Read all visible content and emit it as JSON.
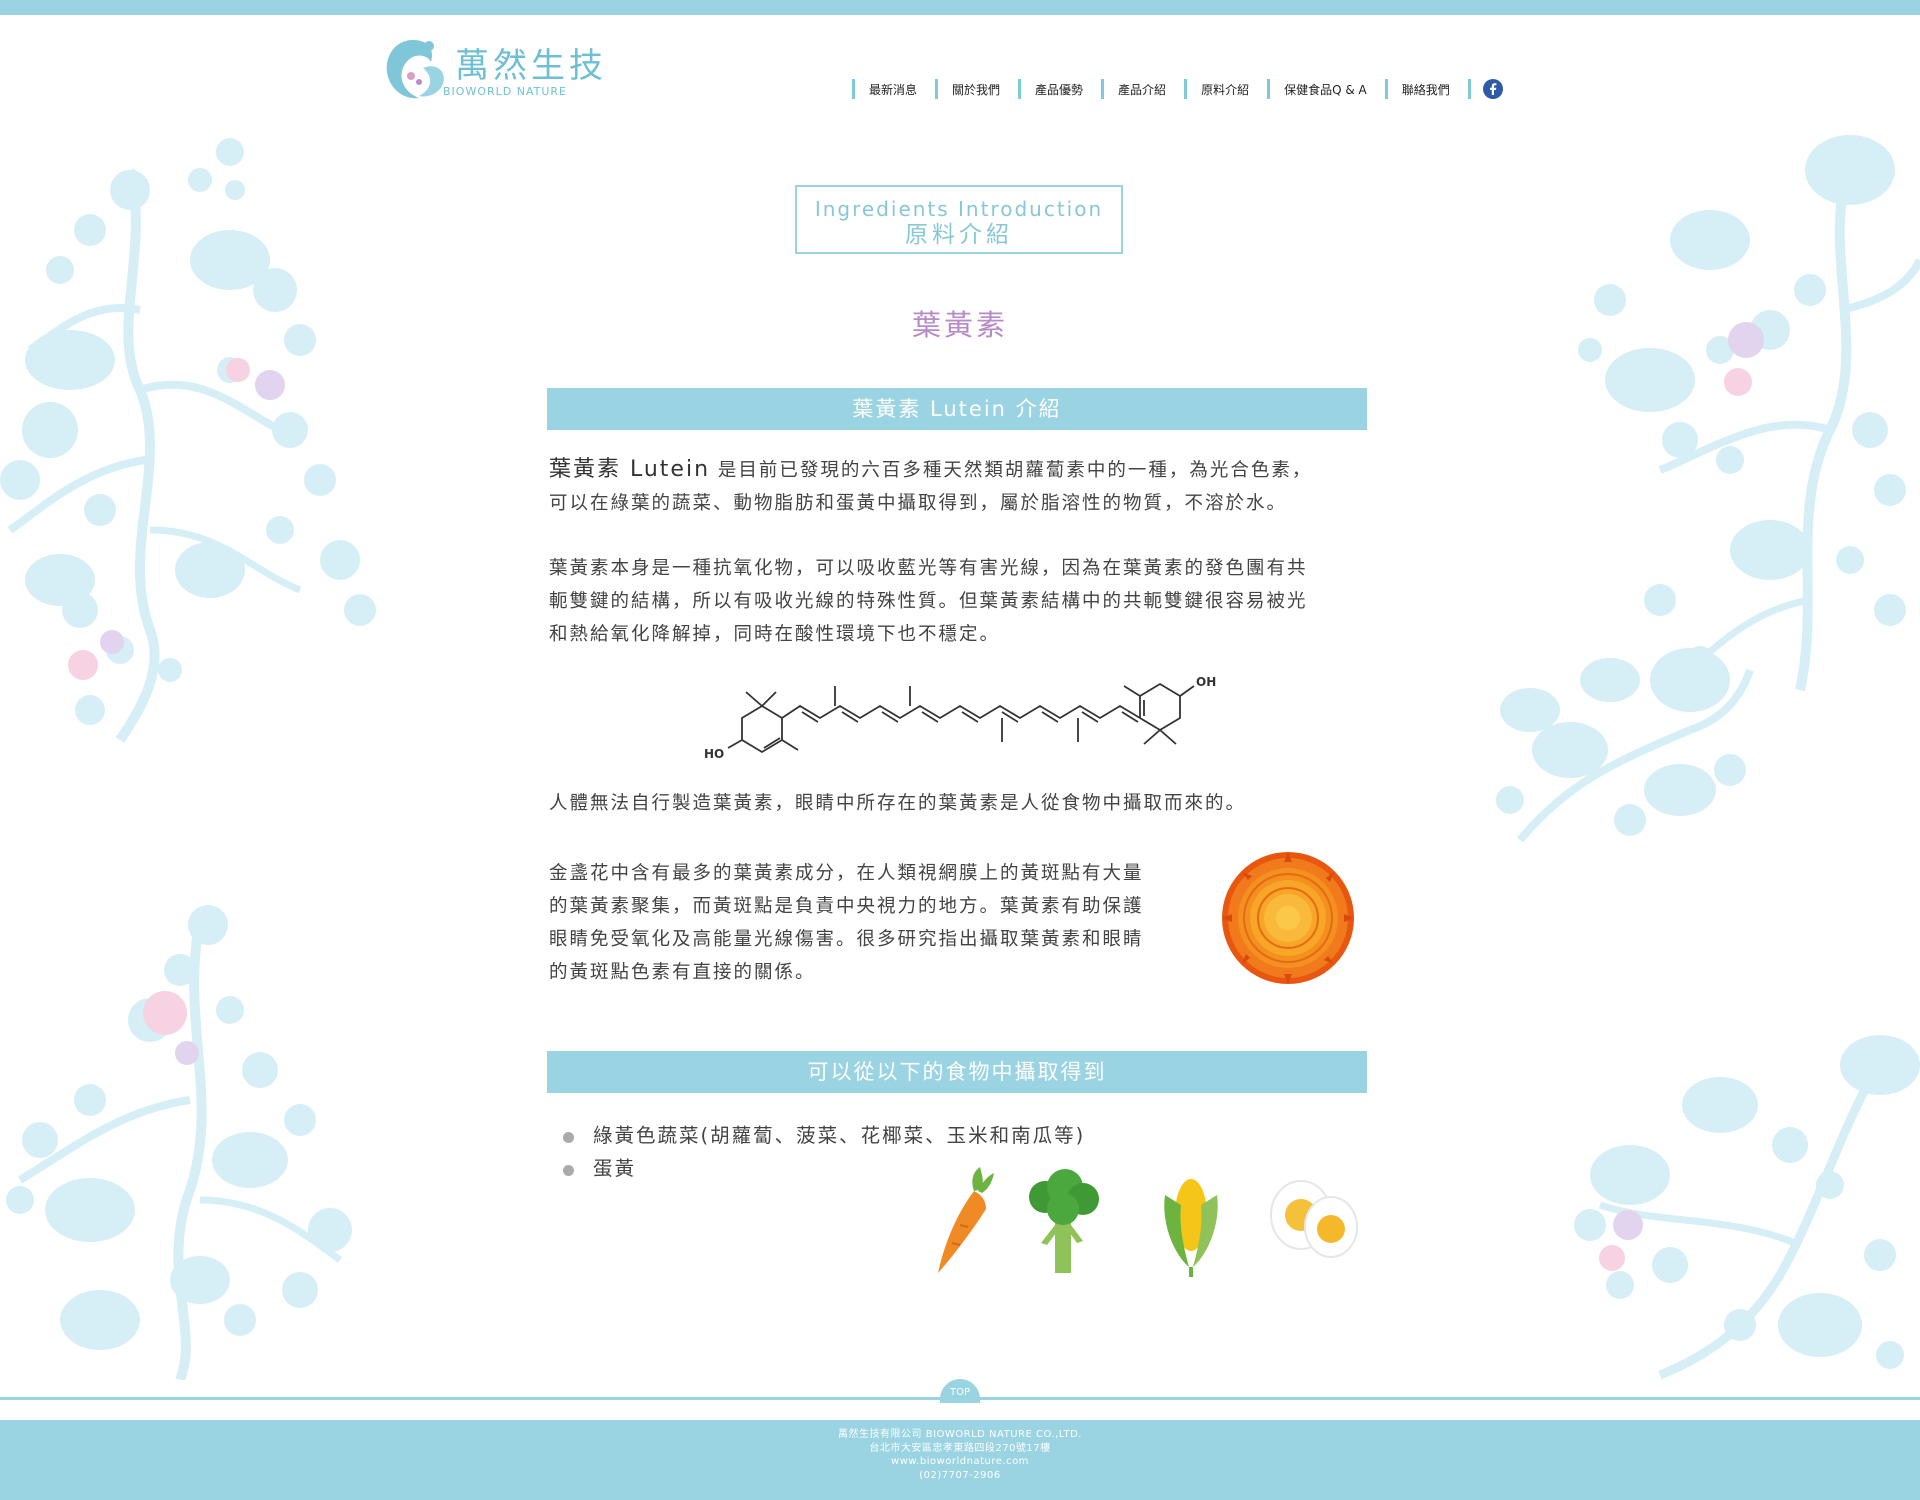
{
  "brand": {
    "name": "萬然生技",
    "sub": "BIOWORLD NATURE"
  },
  "nav": {
    "items": [
      "最新消息",
      "關於我們",
      "產品優勢",
      "產品介紹",
      "原料介紹",
      "保健食品Q & A",
      "聯絡我們"
    ],
    "facebook_icon": "facebook-icon"
  },
  "section": {
    "en": "Ingredients Introduction",
    "zh": "原料介紹"
  },
  "page_title": "葉黃素",
  "intro_bar": "葉黃素 Lutein 介紹",
  "para1": {
    "lead": "葉黃素 Lutein",
    "line1_rest": " 是目前已發現的六百多種天然類胡蘿蔔素中的一種，為光合色素，",
    "line2": "可以在綠葉的蔬菜、動物脂肪和蛋黃中攝取得到，屬於脂溶性的物質，不溶於水。"
  },
  "para2": [
    "葉黃素本身是一種抗氧化物，可以吸收藍光等有害光線，因為在葉黃素的發色團有共",
    "軛雙鍵的結構，所以有吸收光線的特殊性質。但葉黃素結構中的共軛雙鍵很容易被光",
    "和熱給氧化降解掉，同時在酸性環境下也不穩定。"
  ],
  "molecule": {
    "oh_label": "OH",
    "ho_label": "HO"
  },
  "para3": "人體無法自行製造葉黃素，眼睛中所存在的葉黃素是人從食物中攝取而來的。",
  "para4": [
    "金盞花中含有最多的葉黃素成分，在人類視網膜上的黃斑點有大量",
    "的葉黃素聚集，而黃斑點是負責中央視力的地方。葉黃素有助保護",
    "眼睛免受氧化及高能量光線傷害。很多研究指出攝取葉黃素和眼睛",
    "的黃斑點色素有直接的關係。"
  ],
  "food_bar": "可以從以下的食物中攝取得到",
  "food_list": [
    "綠黃色蔬菜(胡蘿蔔、菠菜、花椰菜、玉米和南瓜等)",
    "蛋黃"
  ],
  "food_icons": [
    "carrot-icon",
    "broccoli-icon",
    "corn-icon",
    "egg-icon"
  ],
  "top_label": "TOP",
  "footer": {
    "company": "萬然生技有限公司 BIOWORLD NATURE CO.,LTD.",
    "address": "台北市大安區忠孝東路四段270號17樓",
    "web": "www.bioworldnature.com",
    "phone": "(02)7707-2906"
  },
  "colors": {
    "accent": "#9ad3e2",
    "title": "#b88ac9",
    "floral": "#d3ecf3"
  }
}
